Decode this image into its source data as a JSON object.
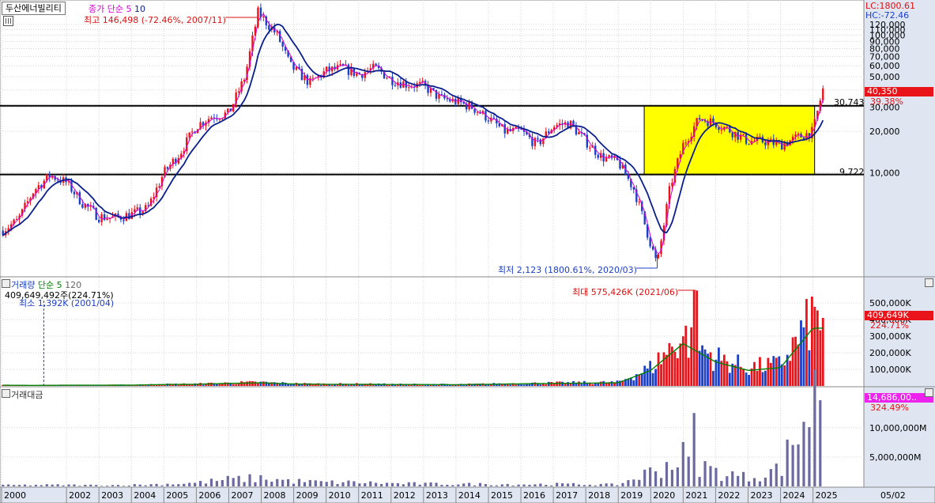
{
  "header": {
    "stock_name": "두산에너빌리티",
    "price_ma_label": "종가 단순",
    "price_ma_fast": "5",
    "price_ma_slow": "10",
    "lc": "LC:1800.61",
    "hc": "HC:-72.46"
  },
  "price_panel": {
    "high_annotation": "최고 146,498 (-72.46%, 2007/11)",
    "low_annotation": "최저 2,123 (1800.61%, 2020/03)",
    "line_upper_label": "30,743",
    "line_lower_label": "9,722",
    "current_price": "40,350",
    "current_change": "39.38%"
  },
  "volume_panel": {
    "title": "거래량",
    "ma_label": "단순",
    "ma_fast": "5",
    "ma_slow": "120",
    "current_line": "409,649,492주(224.71%)",
    "min_annotation": "최소 1,392K (2001/04)",
    "max_annotation": "최대 575,426K (2021/06)",
    "current_value": "409,649K",
    "current_change": "224.71%"
  },
  "amount_panel": {
    "title": "거래대금",
    "current_value": "14,686,00..",
    "current_change": "324.49%"
  },
  "x_axis": {
    "year_labels": [
      "2000",
      "2002",
      "2003",
      "2004",
      "2005",
      "2006",
      "2007",
      "2008",
      "2009",
      "2010",
      "2011",
      "2012",
      "2013",
      "2014",
      "2015",
      "2016",
      "2017",
      "2018",
      "2019",
      "2020",
      "2021",
      "2022",
      "2023",
      "2024",
      "2025"
    ],
    "date_label": "05/02"
  },
  "colors": {
    "up": "#e8141a",
    "down": "#1c3fc8",
    "ma_fast": "#d400d4",
    "ma_slow": "#0a1e8c",
    "vol_ma": "#008000",
    "highlight_box": "#ffff00",
    "axis_bg": "#dfe6f2",
    "amount_bar": "#6a6aa0",
    "amount_current": "#ee22ee"
  },
  "chart_data": [
    {
      "type": "line",
      "name": "price",
      "scale": "log",
      "x": [
        2000.0,
        2000.5,
        2001.0,
        2001.5,
        2002.0,
        2002.5,
        2003.0,
        2003.5,
        2004.0,
        2004.5,
        2005.0,
        2005.5,
        2006.0,
        2006.5,
        2007.0,
        2007.5,
        2007.9,
        2008.5,
        2008.9,
        2009.5,
        2010.0,
        2010.5,
        2011.0,
        2011.5,
        2012.0,
        2012.5,
        2013.0,
        2013.5,
        2014.0,
        2014.5,
        2015.0,
        2015.5,
        2016.0,
        2016.5,
        2017.0,
        2017.5,
        2018.0,
        2018.5,
        2019.0,
        2019.5,
        2020.2,
        2020.6,
        2021.0,
        2021.5,
        2022.0,
        2022.5,
        2023.0,
        2023.5,
        2024.0,
        2024.5,
        2025.0,
        2025.3
      ],
      "y": [
        3800,
        4500,
        7500,
        9600,
        8500,
        6000,
        4800,
        4700,
        5000,
        5500,
        10000,
        14000,
        22000,
        26000,
        27000,
        50000,
        146498,
        100000,
        60000,
        45000,
        55000,
        58000,
        52000,
        58000,
        48000,
        44000,
        43000,
        35000,
        33000,
        30000,
        25000,
        20000,
        20000,
        16000,
        22000,
        23000,
        17000,
        13000,
        12000,
        7500,
        2123,
        8000,
        16000,
        25000,
        23000,
        20000,
        17000,
        17000,
        16000,
        18000,
        20000,
        40350
      ],
      "yticks": [
        "10,000",
        "20,000",
        "30,000",
        "40,000",
        "50,000",
        "60,000",
        "70,000",
        "80,000",
        "90,000",
        "100,000",
        "110,000",
        "120,000"
      ],
      "horizontal_lines": [
        30743,
        9722
      ],
      "highlight_range": {
        "x": [
          2019.8,
          2025.05
        ],
        "y": [
          9722,
          30743
        ]
      }
    },
    {
      "type": "bar",
      "name": "volume",
      "x": [
        2000,
        2001,
        2002,
        2003,
        2004,
        2005,
        2006,
        2007,
        2008,
        2009,
        2010,
        2011,
        2012,
        2013,
        2014,
        2015,
        2016,
        2017,
        2018,
        2019,
        2020,
        2021,
        2022,
        2023,
        2024,
        2025
      ],
      "values": [
        5,
        4,
        5,
        5,
        6,
        10,
        12,
        18,
        22,
        14,
        12,
        12,
        10,
        10,
        9,
        12,
        15,
        18,
        20,
        22,
        110,
        300,
        170,
        110,
        130,
        409.649
      ],
      "unit": "K×1000",
      "yticks": [
        "100,000K",
        "200,000K",
        "300,000K",
        "400,000K",
        "500,000K"
      ]
    },
    {
      "type": "bar",
      "name": "amount",
      "x": [
        2000,
        2001,
        2002,
        2003,
        2004,
        2005,
        2006,
        2007,
        2008,
        2009,
        2010,
        2011,
        2012,
        2013,
        2014,
        2015,
        2016,
        2017,
        2018,
        2019,
        2020,
        2021,
        2022,
        2023,
        2024,
        2025
      ],
      "values": [
        200,
        250,
        250,
        200,
        250,
        400,
        600,
        1200,
        1400,
        900,
        700,
        700,
        500,
        450,
        400,
        400,
        350,
        400,
        350,
        300,
        2500,
        5000,
        2500,
        1500,
        3000,
        14686
      ],
      "unit": "M",
      "yticks": [
        "5,000,000M",
        "10,000,000M"
      ]
    }
  ]
}
